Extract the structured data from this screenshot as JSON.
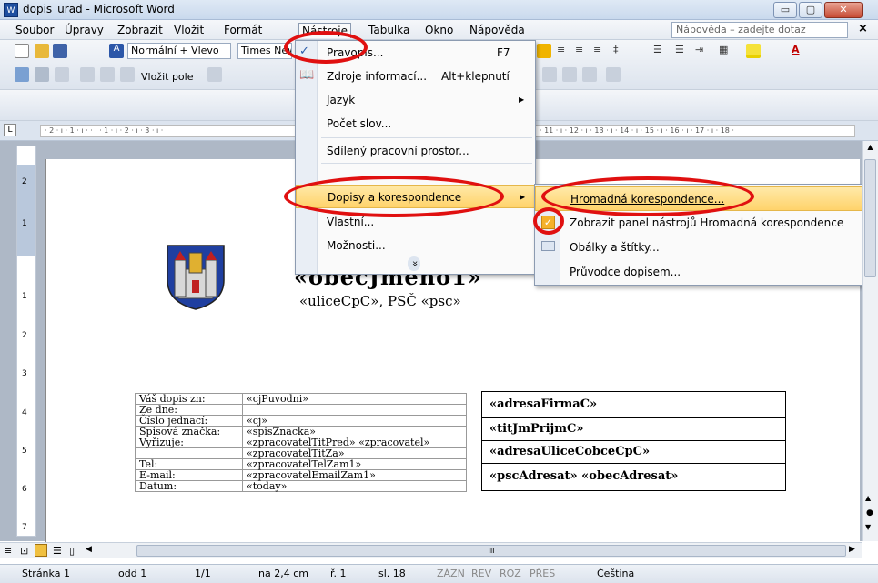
{
  "window": {
    "title": "dopis_urad - Microsoft Word",
    "icon": "word-doc-icon",
    "minimize": "▭",
    "maximize": "▢",
    "close": "✕"
  },
  "menu": {
    "items": [
      "Soubor",
      "Úpravy",
      "Zobrazit",
      "Vložit",
      "Formát",
      "Nástroje",
      "Tabulka",
      "Okno",
      "Nápověda"
    ],
    "help_placeholder": "Nápověda – zadejte dotaz",
    "doc_close": "×"
  },
  "toolbar1": {
    "style": "Normální + Vlevo",
    "font": "Times New Roman"
  },
  "toolbar2": {
    "insert_field": "Vložit pole"
  },
  "ruler": {
    "corner": "L",
    "left_ticks": "· 2 · ı · 1 · ı ·  · ı · 1 · ı · 2 · ı · 3 · ı ·",
    "right_ticks": "· 11 · ı · 12 · ı · 13 · ı · 14 · ı · 15 · ı · 16 · ı · 17 · ı · 18 ·"
  },
  "vruler": {
    "ticks": [
      "2",
      "1",
      "1",
      "2",
      "3",
      "4",
      "5",
      "6",
      "7"
    ]
  },
  "tools_menu": {
    "items": [
      {
        "label": "Pravopis...",
        "shortcut": "F7"
      },
      {
        "label": "Zdroje informací...",
        "shortcut": "Alt+klepnutí"
      },
      {
        "label": "Jazyk",
        "arrow": "▶"
      },
      {
        "label": "Počet slov..."
      },
      {
        "label": "Sdílený pracovní prostor..."
      },
      {
        "label": "Dopisy a korespondence",
        "arrow": "▶"
      },
      {
        "label": "Vlastní..."
      },
      {
        "label": "Možnosti..."
      }
    ],
    "expand": "»"
  },
  "submenu": {
    "items": [
      {
        "label": "Hromadná korespondence..."
      },
      {
        "label": "Zobrazit panel nástrojů Hromadná korespondence"
      },
      {
        "label": "Obálky a štítky..."
      },
      {
        "label": "Průvodce dopisem..."
      }
    ]
  },
  "document": {
    "heading": "«obecJmeno1»",
    "address": "«uliceCpC», PSČ «psc»",
    "info_table": [
      [
        "Váš dopis zn:",
        "«cjPuvodni»"
      ],
      [
        "Ze dne:",
        ""
      ],
      [
        "Číslo jednací:",
        "«cj»"
      ],
      [
        "Spisová značka:",
        "«spisZnacka»"
      ],
      [
        "Vyřizuje:",
        "«zpracovatelTitPred» «zpracovatel»"
      ],
      [
        "",
        "«zpracovatelTitZa»"
      ],
      [
        "Tel:",
        "«zpracovatelTelZam1»"
      ],
      [
        "E-mail:",
        "«zpracovatelEmailZam1»"
      ],
      [
        "Datum:",
        "«today»"
      ]
    ],
    "recipient": [
      "«adresaFirmaC»",
      "«titJmPrijmC»",
      "«adresaUliceCobceCpC»",
      "«pscAdresat» «obecAdresat»"
    ]
  },
  "hscroll": {
    "center": "III"
  },
  "status": {
    "page": "Stránka 1",
    "section": "odd 1",
    "pages": "1/1",
    "position": "na 2,4 cm",
    "line": "ř. 1",
    "column": "sl. 18",
    "rec": "ZÁZN",
    "trk": "REV",
    "ext": "ROZ",
    "ovr": "PŘES",
    "language": "Čeština"
  },
  "colors": {
    "highlight": "#ffd36b",
    "annotation": "#e01010",
    "titlebar": "#c9d9ed"
  }
}
